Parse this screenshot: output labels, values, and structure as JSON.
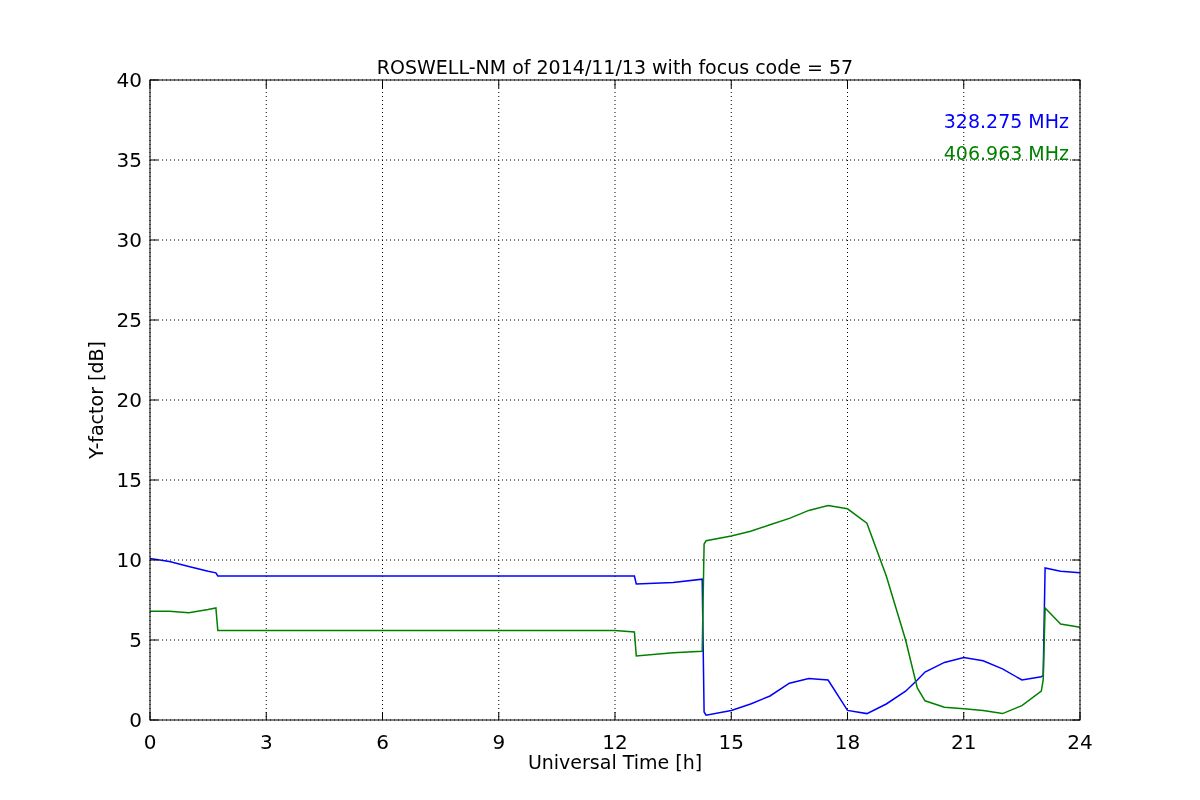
{
  "chart_data": {
    "type": "line",
    "title": "ROSWELL-NM of 2014/11/13 with focus code = 57",
    "xlabel": "Universal Time [h]",
    "ylabel": "Y-factor [dB]",
    "x": [
      0,
      0.5,
      1,
      1.5,
      1.7,
      1.75,
      6,
      12,
      12.5,
      12.55,
      13.5,
      14.25,
      14.3,
      14.35,
      15,
      15.5,
      16,
      16.5,
      17,
      17.5,
      18,
      18.5,
      19,
      19.5,
      19.8,
      20,
      20.5,
      21,
      21.5,
      22,
      22.5,
      23,
      23.05,
      23.1,
      23.5,
      24
    ],
    "series": [
      {
        "name": "328.275 MHz",
        "color": "#0000ff",
        "values": [
          10.1,
          9.9,
          9.6,
          9.3,
          9.2,
          9,
          9,
          9,
          9,
          8.5,
          8.6,
          8.8,
          0.5,
          0.3,
          0.6,
          1,
          1.5,
          2.3,
          2.6,
          2.5,
          0.6,
          0.4,
          1,
          1.8,
          2.5,
          3,
          3.6,
          3.9,
          3.7,
          3.2,
          2.5,
          2.7,
          2.8,
          9.5,
          9.3,
          9.2
        ]
      },
      {
        "name": "406.963 MHz",
        "color": "#008000",
        "values": [
          6.8,
          6.8,
          6.7,
          6.9,
          7,
          5.6,
          5.6,
          5.6,
          5.5,
          4,
          4.2,
          4.3,
          11,
          11.2,
          11.5,
          11.8,
          12.2,
          12.6,
          13.1,
          13.4,
          13.2,
          12.3,
          9,
          5,
          2,
          1.2,
          0.8,
          0.7,
          0.6,
          0.4,
          0.9,
          1.8,
          2.5,
          7,
          6,
          5.8
        ]
      }
    ],
    "xlim": [
      0,
      24
    ],
    "ylim": [
      0,
      40
    ],
    "xticks": [
      0,
      3,
      6,
      9,
      12,
      15,
      18,
      21,
      24
    ],
    "yticks": [
      0,
      5,
      10,
      15,
      20,
      25,
      30,
      35,
      40
    ],
    "grid": true
  }
}
